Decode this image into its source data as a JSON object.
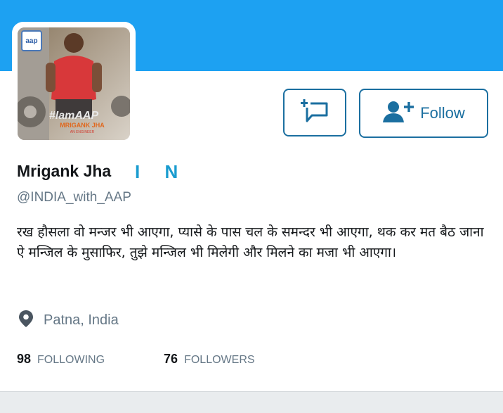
{
  "profile": {
    "name": "Mrigank Jha",
    "badge": "I N",
    "handle": "@INDIA_with_AAP",
    "bio": "रख हौसला वो मन्जर भी आएगा,  प्यासे के पास चल के समन्दर भी आएगा,  थक कर मत बैठ जाना ऐ मन्जिल के मुसाफिर,  तुझे मन्जिल भी मिलेगी और मिलने का मजा भी आएगा।",
    "location": "Patna, India",
    "avatar_text": {
      "logo": "aap",
      "hashtag": "#IamAAP",
      "overlay_name": "MRIGANK JHA",
      "overlay_sub": "AN ENGINEER"
    }
  },
  "actions": {
    "follow_label": "Follow"
  },
  "stats": {
    "following_count": "98",
    "following_label": "FOLLOWING",
    "followers_count": "76",
    "followers_label": "FOLLOWERS"
  },
  "colors": {
    "banner": "#1da1f2",
    "button_accent": "#1b6fa0",
    "badge": "#1a9ccf",
    "muted_text": "#657786"
  },
  "icons": [
    "new-message-icon",
    "add-user-icon",
    "location-pin-icon"
  ]
}
